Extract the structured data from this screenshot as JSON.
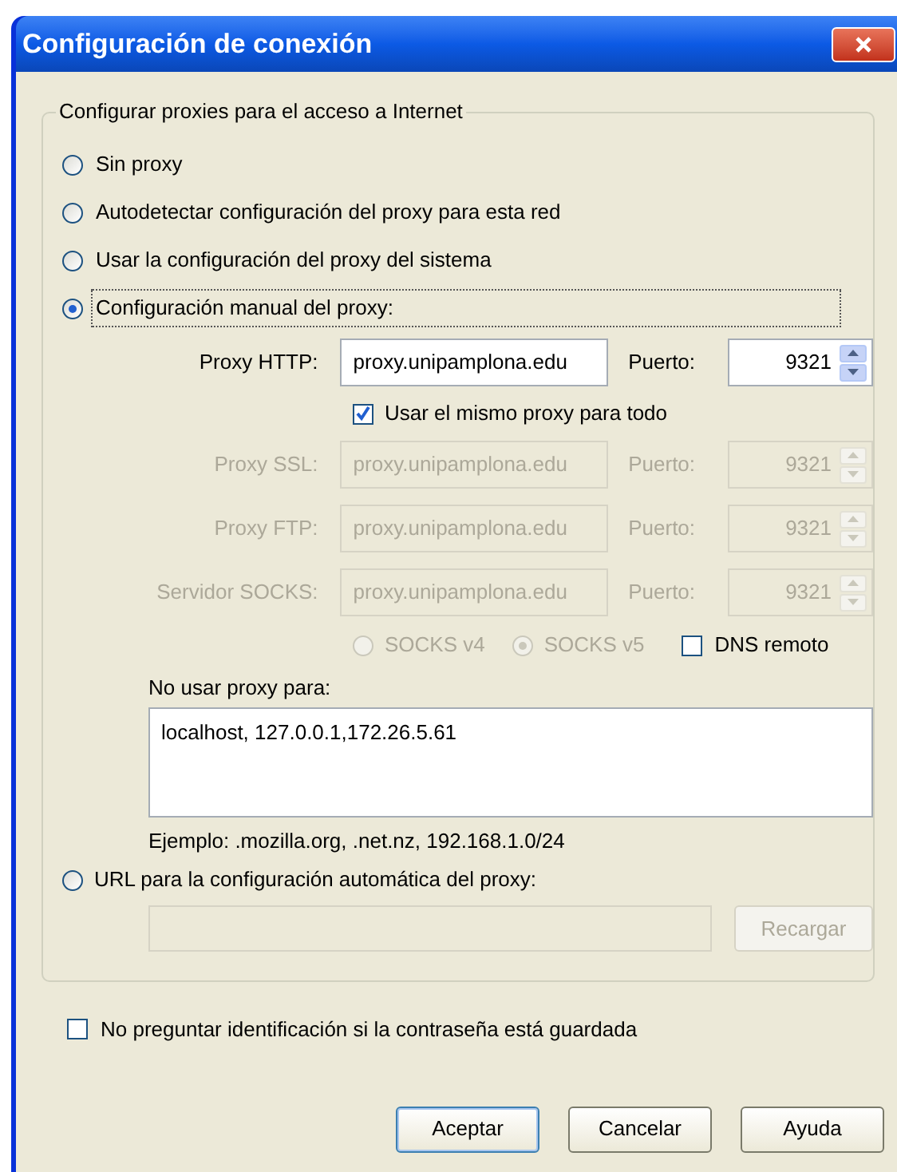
{
  "window": {
    "title": "Configuración de conexión"
  },
  "group": {
    "title": "Configurar proxies para el acceso a Internet",
    "modes": [
      {
        "label": "Sin proxy",
        "selected": false,
        "focused": false
      },
      {
        "label": "Autodetectar configuración del proxy para esta red",
        "selected": false,
        "focused": false
      },
      {
        "label": "Usar la configuración del proxy del sistema",
        "selected": false,
        "focused": false
      },
      {
        "label": "Configuración manual del proxy:",
        "selected": true,
        "focused": true
      }
    ],
    "manual": {
      "proxies": [
        {
          "label": "Proxy HTTP:",
          "value": "proxy.unipamplona.edu",
          "port_label": "Puerto:",
          "port": "9321",
          "disabled": false
        },
        {
          "label": "Proxy SSL:",
          "value": "proxy.unipamplona.edu",
          "port_label": "Puerto:",
          "port": "9321",
          "disabled": true
        },
        {
          "label": "Proxy FTP:",
          "value": "proxy.unipamplona.edu",
          "port_label": "Puerto:",
          "port": "9321",
          "disabled": true
        },
        {
          "label": "Servidor SOCKS:",
          "value": "proxy.unipamplona.edu",
          "port_label": "Puerto:",
          "port": "9321",
          "disabled": true
        }
      ],
      "same_proxy": {
        "label": "Usar el mismo proxy para todo",
        "checked": true
      },
      "socks_versions": [
        {
          "label": "SOCKS v4",
          "selected": false,
          "disabled": true
        },
        {
          "label": "SOCKS v5",
          "selected": true,
          "disabled": true
        }
      ],
      "remote_dns": {
        "label": "DNS remoto",
        "checked": false
      },
      "no_proxy": {
        "label": "No usar proxy para:",
        "value": "localhost, 127.0.0.1,172.26.5.61"
      },
      "example": "Ejemplo: .mozilla.org, .net.nz, 192.168.1.0/24"
    },
    "auto_url": {
      "label": "URL para la configuración automática del proxy:",
      "selected": false,
      "reload_button": "Recargar",
      "reload_disabled": true
    }
  },
  "no_password_prompt": {
    "label": "No preguntar identificación si la contraseña está guardada",
    "checked": false
  },
  "buttons": [
    {
      "label": "Aceptar",
      "default": true
    },
    {
      "label": "Cancelar",
      "default": false
    },
    {
      "label": "Ayuda",
      "default": false
    }
  ]
}
